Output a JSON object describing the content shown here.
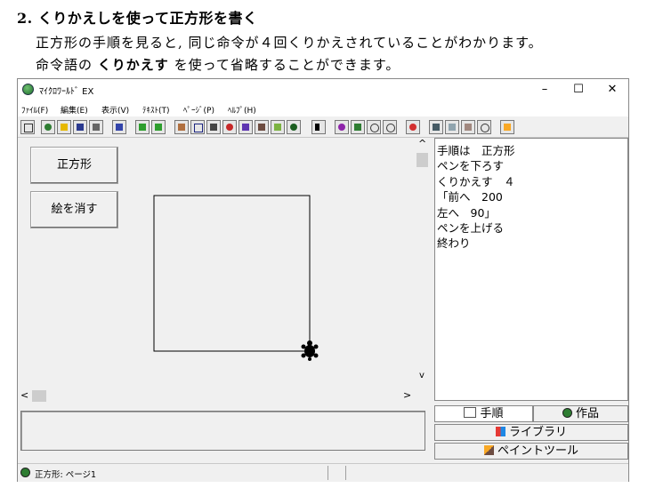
{
  "doc": {
    "heading": "2. くりかえしを使って正方形を書く",
    "para1": "正方形の手順を見ると, 同じ命令が４回くりかえされていることがわかります。",
    "para2_before": "命令語の",
    "para2_keyword": "くりかえす",
    "para2_after": "を使って省略することができます。"
  },
  "window": {
    "title": "ﾏｲｸﾛﾜｰﾙﾄﾞ EX",
    "minimize": "–",
    "maximize": "☐",
    "close": "✕"
  },
  "menu": [
    "ﾌｧｲﾙ(F)",
    "編集(E)",
    "表示(V)",
    "ﾃｷｽﾄ(T)",
    "ﾍﾟｰｼﾞ(P)",
    "ﾍﾙﾌﾟ(H)"
  ],
  "buttons": {
    "square": "正方形",
    "clear": "絵を消す"
  },
  "program": {
    "lines": [
      "手順は　正方形",
      "ペンを下ろす",
      "くりかえす　４",
      "「前へ　200",
      "左へ　90」",
      "ペンを上げる",
      "終わり"
    ]
  },
  "tabs": {
    "procedure": "手順",
    "works": "作品",
    "library": "ライブラリ",
    "paint": "ペイントツール"
  },
  "status": {
    "page": "正方形: ページ1"
  },
  "scroll": {
    "up": "^",
    "down": "v",
    "left": "<",
    "right": ">"
  },
  "colors": {
    "accent_green": "#1f6f2f",
    "window_bg": "#f0f0f0"
  }
}
